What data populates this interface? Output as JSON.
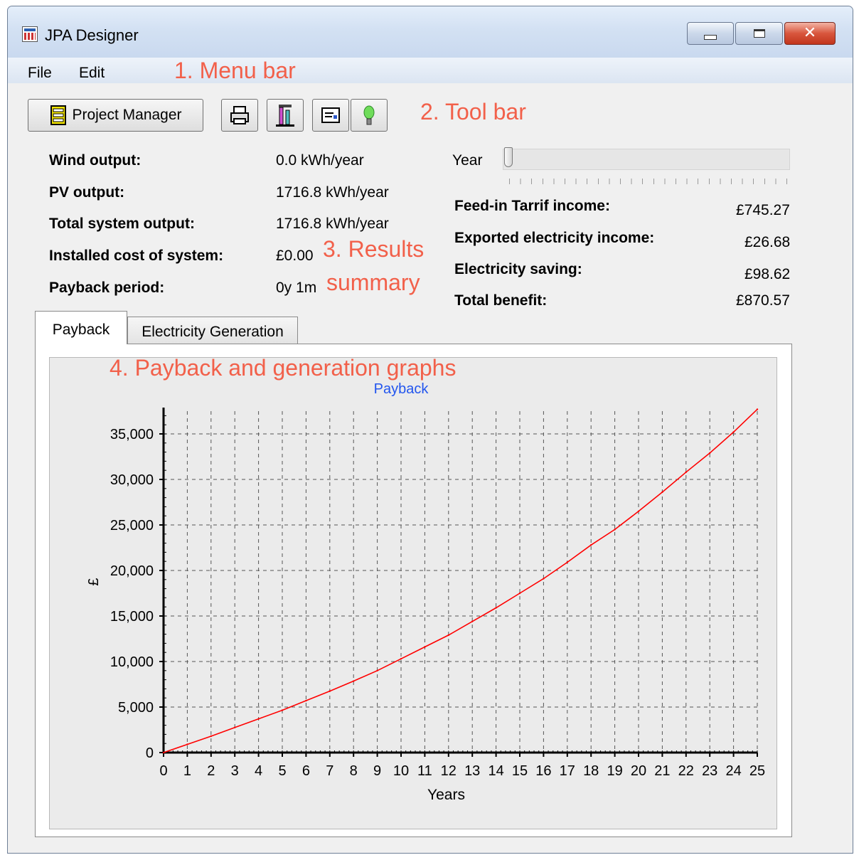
{
  "window": {
    "title": "JPA Designer"
  },
  "menu": [
    "File",
    "Edit"
  ],
  "annotations": {
    "menu_bar": "1. Menu bar",
    "tool_bar": "2. Tool bar",
    "results_line1": "3. Results",
    "results_line2": "summary",
    "graphs": "4. Payback and generation graphs"
  },
  "toolbar": {
    "project_manager": "Project Manager",
    "icons": [
      "print-icon",
      "chart-icon",
      "document-icon",
      "bulb-icon"
    ]
  },
  "results": {
    "left": [
      {
        "label": "Wind output:",
        "value": "0.0 kWh/year"
      },
      {
        "label": "PV output:",
        "value": "1716.8 kWh/year"
      },
      {
        "label": "Total system output:",
        "value": "1716.8 kWh/year"
      },
      {
        "label": "Installed cost of system:",
        "value": "£0.00"
      },
      {
        "label": "Payback period:",
        "value": "0y 1m"
      }
    ],
    "year_label": "Year",
    "year_slider_value": 0,
    "right": [
      {
        "label": "Feed-in Tarrif income:",
        "value": "£745.27"
      },
      {
        "label": "Exported electricity income:",
        "value": "£26.68"
      },
      {
        "label": "Electricity saving:",
        "value": "£98.62"
      },
      {
        "label": "Total benefit:",
        "value": "£870.57"
      }
    ]
  },
  "tabs": [
    {
      "label": "Payback",
      "active": true
    },
    {
      "label": "Electricity Generation",
      "active": false
    }
  ],
  "chart_data": {
    "type": "line",
    "title": "Payback",
    "xlabel": "Years",
    "ylabel": "£",
    "xlim": [
      0,
      25
    ],
    "ylim": [
      0,
      37500
    ],
    "xticks": [
      0,
      1,
      2,
      3,
      4,
      5,
      6,
      7,
      8,
      9,
      10,
      11,
      12,
      13,
      14,
      15,
      16,
      17,
      18,
      19,
      20,
      21,
      22,
      23,
      24,
      25
    ],
    "yticks": [
      0,
      5000,
      10000,
      15000,
      20000,
      25000,
      30000,
      35000
    ],
    "ytick_labels": [
      "0",
      "5,000",
      "10,000",
      "15,000",
      "20,000",
      "25,000",
      "30,000",
      "35,000"
    ],
    "grid": true,
    "series": [
      {
        "color": "#ff0000",
        "x": [
          0,
          1,
          2,
          3,
          4,
          5,
          6,
          7,
          8,
          9,
          10,
          11,
          12,
          13,
          14,
          15,
          16,
          17,
          18,
          19,
          20,
          21,
          22,
          23,
          24,
          25
        ],
        "values": [
          0,
          900,
          1800,
          2750,
          3700,
          4650,
          5700,
          6750,
          7850,
          9000,
          10300,
          11600,
          12900,
          14400,
          15900,
          17500,
          19100,
          20900,
          22800,
          24500,
          26500,
          28600,
          30800,
          32900,
          35200,
          37700
        ]
      }
    ],
    "title_color": "#2255ee"
  }
}
